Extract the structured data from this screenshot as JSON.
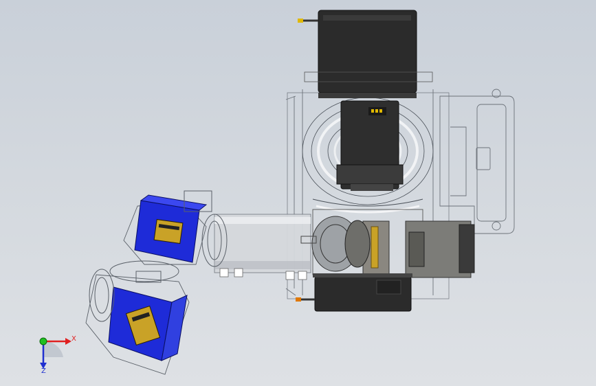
{
  "viewport": {
    "background_top": "#c9d0d9",
    "background_bottom": "#dee1e5"
  },
  "triad": {
    "x_label": "X",
    "z_label": "Z",
    "x_color": "#e02020",
    "y_color": "#20c020",
    "z_color": "#2030d0"
  },
  "model": {
    "servo_dark_color": "#2d2d2d",
    "servo_blue_color": "#1e2bd8",
    "label_gold_color": "#c9a227",
    "connector_gold_color": "#e0b800"
  }
}
